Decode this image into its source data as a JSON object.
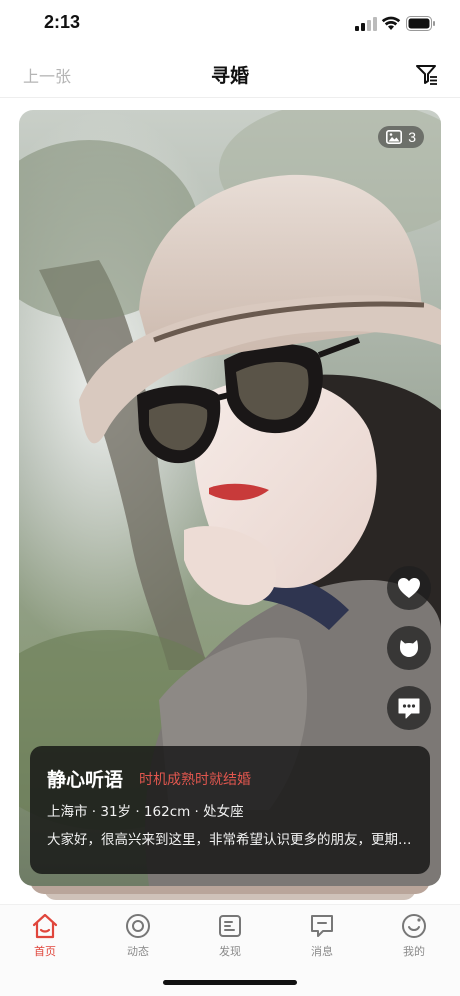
{
  "status_bar": {
    "time": "2:13"
  },
  "nav": {
    "prev_label": "上一张",
    "title": "寻婚"
  },
  "profile": {
    "photo_count": "3",
    "name": "静心听语",
    "tagline": "时机成熟时就结婚",
    "details": "上海市 · 31岁 · 162cm · 处女座",
    "bio": "大家好，很高兴来到这里，非常希望认识更多的朋友，更期待遇见那个对的人"
  },
  "tabs": [
    {
      "label": "首页",
      "icon": "home-icon",
      "active": true
    },
    {
      "label": "动态",
      "icon": "moments-icon",
      "active": false
    },
    {
      "label": "发现",
      "icon": "discover-icon",
      "active": false
    },
    {
      "label": "消息",
      "icon": "message-icon",
      "active": false
    },
    {
      "label": "我的",
      "icon": "profile-icon",
      "active": false
    }
  ],
  "colors": {
    "accent": "#e0463c",
    "tagline": "#e0564e"
  }
}
